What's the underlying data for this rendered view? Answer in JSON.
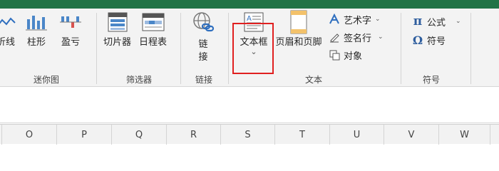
{
  "ribbon": {
    "sparklines": {
      "label": "迷你图",
      "line": "折线",
      "column": "柱形",
      "winloss": "盈亏"
    },
    "filters": {
      "label": "筛选器",
      "slicer": "切片器",
      "timeline": "日程表"
    },
    "links": {
      "label": "链接",
      "link_line1": "链",
      "link_line2": "接"
    },
    "text": {
      "label": "文本",
      "textbox": "文本框",
      "textbox_caret": "⌄",
      "header_footer": "页眉和页脚",
      "wordart": "艺术字",
      "signature": "签名行",
      "object": "对象"
    },
    "symbols": {
      "label": "符号",
      "equation": "公式",
      "symbol": "符号",
      "equation_glyph": "π",
      "symbol_glyph": "Ω"
    }
  },
  "columns": [
    "O",
    "P",
    "Q",
    "R",
    "S",
    "T",
    "U",
    "V",
    "W"
  ],
  "colors": {
    "accent": "#217346",
    "highlight": "#e02020"
  }
}
